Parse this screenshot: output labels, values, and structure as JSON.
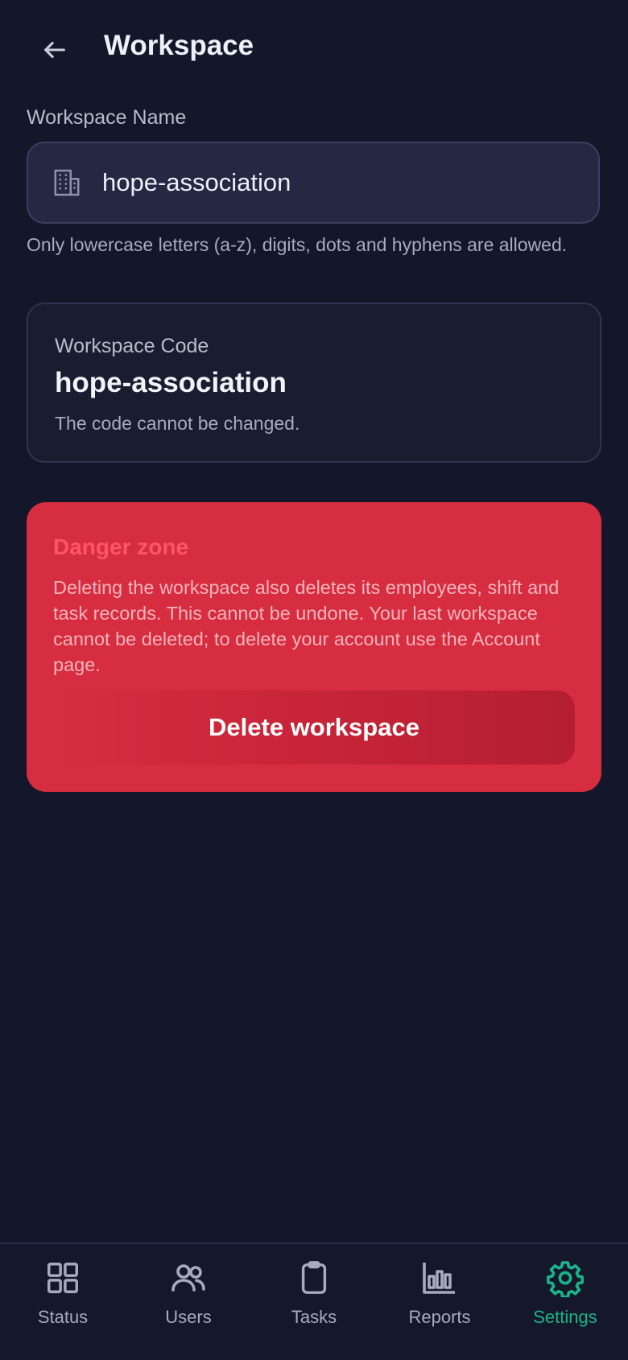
{
  "header": {
    "title": "Workspace"
  },
  "name_field": {
    "label": "Workspace Name",
    "value": "hope-association",
    "hint": "Only lowercase letters (a-z), digits, dots and hyphens are allowed."
  },
  "code_card": {
    "label": "Workspace Code",
    "value": "hope-association",
    "note": "The code cannot be changed."
  },
  "danger_zone": {
    "title": "Danger zone",
    "text": "Deleting the workspace also deletes its employees, shift and task records. This cannot be undone. Your last workspace cannot be deleted; to delete your account use the Account page.",
    "button_label": "Delete workspace"
  },
  "nav": {
    "items": [
      {
        "label": "Status",
        "icon": "grid-icon"
      },
      {
        "label": "Users",
        "icon": "users-icon"
      },
      {
        "label": "Tasks",
        "icon": "clipboard-icon"
      },
      {
        "label": "Reports",
        "icon": "bar-chart-icon"
      },
      {
        "label": "Settings",
        "icon": "gear-icon",
        "active": true
      }
    ]
  },
  "colors": {
    "accent": "#1bb488",
    "danger": "#d72d40",
    "background": "#14172a"
  }
}
